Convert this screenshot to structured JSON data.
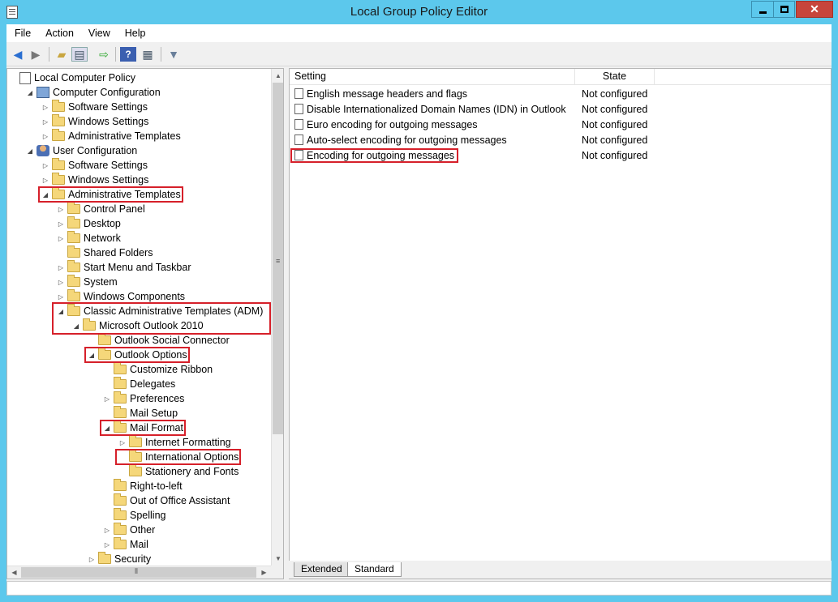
{
  "window": {
    "title": "Local Group Policy Editor"
  },
  "menubar": [
    "File",
    "Action",
    "View",
    "Help"
  ],
  "toolbar": {
    "icons": [
      "back-arrow-icon",
      "forward-arrow-icon",
      "up-folder-icon",
      "show-hide-tree-icon",
      "export-list-icon",
      "help-icon",
      "properties-icon",
      "filter-icon"
    ]
  },
  "tree": [
    {
      "label": "Local Computer Policy",
      "depth": 0,
      "exp": "",
      "icon": "doc",
      "highlight": false
    },
    {
      "label": "Computer Configuration",
      "depth": 1,
      "exp": "open",
      "icon": "pc",
      "highlight": false
    },
    {
      "label": "Software Settings",
      "depth": 2,
      "exp": "closed",
      "icon": "folder",
      "highlight": false
    },
    {
      "label": "Windows Settings",
      "depth": 2,
      "exp": "closed",
      "icon": "folder",
      "highlight": false
    },
    {
      "label": "Administrative Templates",
      "depth": 2,
      "exp": "closed",
      "icon": "folder",
      "highlight": false
    },
    {
      "label": "User Configuration",
      "depth": 1,
      "exp": "open",
      "icon": "user",
      "highlight": false
    },
    {
      "label": "Software Settings",
      "depth": 2,
      "exp": "closed",
      "icon": "folder",
      "highlight": false
    },
    {
      "label": "Windows Settings",
      "depth": 2,
      "exp": "closed",
      "icon": "folder",
      "highlight": false
    },
    {
      "label": "Administrative Templates",
      "depth": 2,
      "exp": "open",
      "icon": "folder",
      "highlight": true
    },
    {
      "label": "Control Panel",
      "depth": 3,
      "exp": "closed",
      "icon": "folder",
      "highlight": false
    },
    {
      "label": "Desktop",
      "depth": 3,
      "exp": "closed",
      "icon": "folder",
      "highlight": false
    },
    {
      "label": "Network",
      "depth": 3,
      "exp": "closed",
      "icon": "folder",
      "highlight": false
    },
    {
      "label": "Shared Folders",
      "depth": 3,
      "exp": "",
      "icon": "folder",
      "highlight": false
    },
    {
      "label": "Start Menu and Taskbar",
      "depth": 3,
      "exp": "closed",
      "icon": "folder",
      "highlight": false
    },
    {
      "label": "System",
      "depth": 3,
      "exp": "closed",
      "icon": "folder",
      "highlight": false
    },
    {
      "label": "Windows Components",
      "depth": 3,
      "exp": "closed",
      "icon": "folder",
      "highlight": false
    },
    {
      "label": "Classic Administrative Templates (ADM)",
      "depth": 3,
      "exp": "open",
      "icon": "folder",
      "highlight": false
    },
    {
      "label": "Microsoft Outlook 2010",
      "depth": 4,
      "exp": "open",
      "icon": "folder",
      "highlight": false
    },
    {
      "label": "Outlook Social Connector",
      "depth": 5,
      "exp": "",
      "icon": "folder",
      "highlight": false
    },
    {
      "label": "Outlook Options",
      "depth": 5,
      "exp": "open",
      "icon": "folder",
      "highlight": true
    },
    {
      "label": "Customize Ribbon",
      "depth": 6,
      "exp": "",
      "icon": "folder",
      "highlight": false
    },
    {
      "label": "Delegates",
      "depth": 6,
      "exp": "",
      "icon": "folder",
      "highlight": false
    },
    {
      "label": "Preferences",
      "depth": 6,
      "exp": "closed",
      "icon": "folder",
      "highlight": false
    },
    {
      "label": "Mail Setup",
      "depth": 6,
      "exp": "",
      "icon": "folder",
      "highlight": false
    },
    {
      "label": "Mail Format",
      "depth": 6,
      "exp": "open",
      "icon": "folder",
      "highlight": true
    },
    {
      "label": "Internet Formatting",
      "depth": 7,
      "exp": "closed",
      "icon": "folder",
      "highlight": false
    },
    {
      "label": "International Options",
      "depth": 7,
      "exp": "",
      "icon": "folder",
      "highlight": true
    },
    {
      "label": "Stationery and Fonts",
      "depth": 7,
      "exp": "",
      "icon": "folder",
      "highlight": false
    },
    {
      "label": "Right-to-left",
      "depth": 6,
      "exp": "",
      "icon": "folder",
      "highlight": false
    },
    {
      "label": "Out of Office Assistant",
      "depth": 6,
      "exp": "",
      "icon": "folder",
      "highlight": false
    },
    {
      "label": "Spelling",
      "depth": 6,
      "exp": "",
      "icon": "folder",
      "highlight": false
    },
    {
      "label": "Other",
      "depth": 6,
      "exp": "closed",
      "icon": "folder",
      "highlight": false
    },
    {
      "label": "Mail",
      "depth": 6,
      "exp": "closed",
      "icon": "folder",
      "highlight": false
    },
    {
      "label": "Security",
      "depth": 5,
      "exp": "closed",
      "icon": "folder",
      "highlight": false
    }
  ],
  "list": {
    "columns": [
      "Setting",
      "State"
    ],
    "rows": [
      {
        "setting": "English message headers and flags",
        "state": "Not configured",
        "highlight": false
      },
      {
        "setting": "Disable Internationalized Domain Names (IDN) in Outlook",
        "state": "Not configured",
        "highlight": false
      },
      {
        "setting": "Euro encoding for outgoing messages",
        "state": "Not configured",
        "highlight": false
      },
      {
        "setting": "Auto-select encoding for outgoing messages",
        "state": "Not configured",
        "highlight": false
      },
      {
        "setting": "Encoding for outgoing messages",
        "state": "Not configured",
        "highlight": true
      }
    ]
  },
  "tabs": [
    "Extended",
    "Standard"
  ],
  "highlight_color": "#d6202a"
}
